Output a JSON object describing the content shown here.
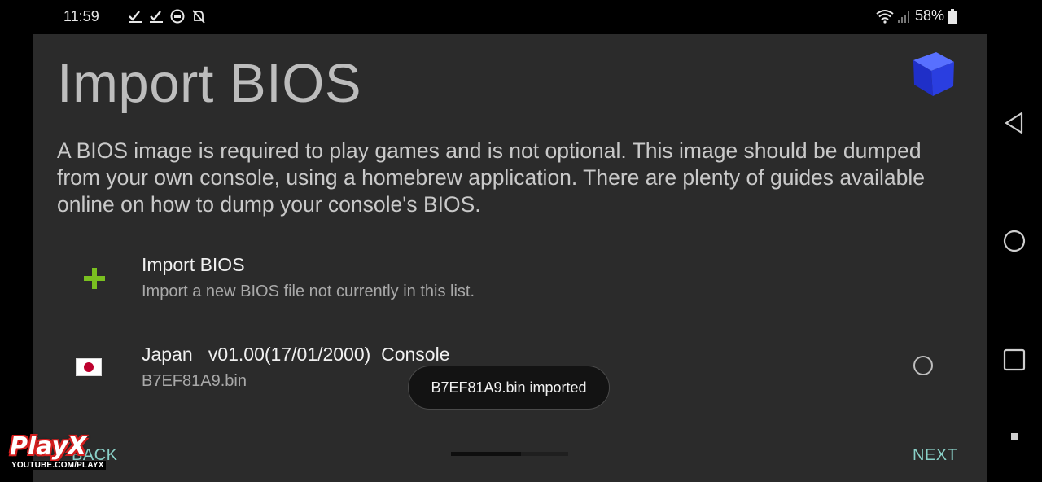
{
  "status_bar": {
    "time": "11:59",
    "battery": "58%",
    "notification_icons": [
      "check-download-icon",
      "check-download-icon",
      "sync-icon",
      "notifications-off-icon"
    ]
  },
  "page": {
    "title": "Import BIOS",
    "description": "A BIOS image is required to play games and is not optional. This image should be dumped from your own console, using a homebrew application. There are plenty of guides available online on how to dump your console's BIOS."
  },
  "bios_items": [
    {
      "icon": "plus-icon",
      "title": "Import BIOS",
      "subtitle": "Import a new BIOS file not currently in this list."
    },
    {
      "icon": "japan-flag-icon",
      "title": "Japan   v01.00(17/01/2000)  Console",
      "subtitle": "B7EF81A9.bin",
      "selected": false
    }
  ],
  "toast": {
    "message": "B7EF81A9.bin imported"
  },
  "footer": {
    "back_label": "BACK",
    "next_label": "NEXT",
    "progress": 0.6
  },
  "watermark": {
    "brand": "PlayX",
    "url": "YOUTUBE.COM/PLAYX"
  },
  "colors": {
    "accent": "#8ad1c8",
    "panel": "#2b2b2b",
    "plus_green": "#7ac020",
    "flag_red": "#bc002d"
  }
}
